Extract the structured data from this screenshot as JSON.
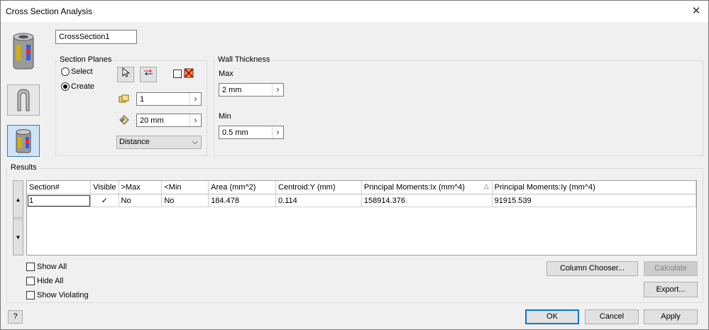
{
  "window": {
    "title": "Cross Section Analysis"
  },
  "name_field": {
    "value": "CrossSection1"
  },
  "section_planes": {
    "label": "Section Planes",
    "select_label": "Select",
    "create_label": "Create",
    "selected": "create",
    "count_value": "1",
    "distance_value": "20 mm",
    "mode_value": "Distance"
  },
  "wall_thickness": {
    "label": "Wall Thickness",
    "max_label": "Max",
    "max_value": "2 mm",
    "min_label": "Min",
    "min_value": "0.5 mm"
  },
  "results": {
    "label": "Results",
    "columns": [
      "Section#",
      "Visible",
      ">Max",
      "<Min",
      "Area (mm^2)",
      "Centroid:Y (mm)",
      "Principal Moments:Ix (mm^4)",
      "Principal Moments:Iy (mm^4)"
    ],
    "rows": [
      {
        "section": "1",
        "visible": "✓",
        "max": "No",
        "min": "No",
        "area": "184.478",
        "centroid_y": "0.114",
        "ix": "158914.376",
        "iy": "91915.539"
      }
    ],
    "sort_indicator": "△"
  },
  "options": {
    "show_all": "Show All",
    "hide_all": "Hide All",
    "show_violating": "Show Violating"
  },
  "buttons": {
    "column_chooser": "Column Chooser...",
    "calculate": "Calculate",
    "export": "Export...",
    "ok": "OK",
    "cancel": "Cancel",
    "apply": "Apply"
  },
  "icons": {
    "help": "?",
    "close": "✕",
    "up": "▲",
    "down": "▼"
  }
}
